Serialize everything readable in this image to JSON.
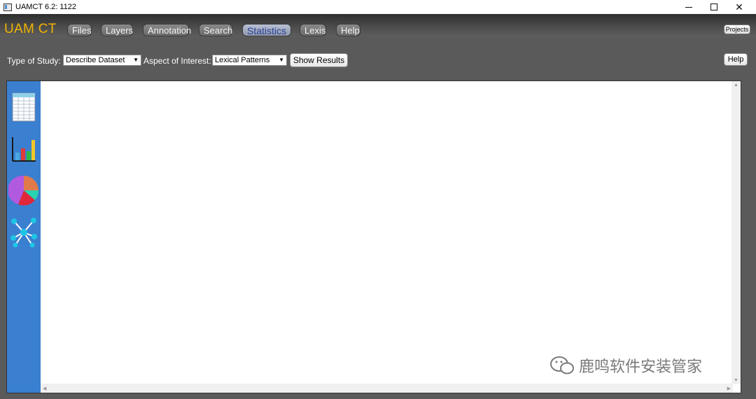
{
  "window": {
    "title": "UAMCT 6.2: 1122",
    "close_glyph": "✕"
  },
  "menubar": {
    "brand": "UAM CT",
    "tabs": [
      {
        "label": "Files"
      },
      {
        "label": "Layers"
      },
      {
        "label": "Annotation"
      },
      {
        "label": "Search"
      },
      {
        "label": "Statistics",
        "active": true
      },
      {
        "label": "Lexis"
      },
      {
        "label": "Help"
      }
    ],
    "projects_label": "Projects"
  },
  "toolbar": {
    "study_label": "Type of Study:",
    "study_value": "Describe Dataset",
    "aspect_label": "Aspect of Interest:",
    "aspect_value": "Lexical Patterns",
    "show_results_label": "Show Results",
    "help_label": "Help",
    "dropdown_glyph": "▼"
  },
  "sidebar": {
    "icons": [
      "spreadsheet-icon",
      "bar-chart-icon",
      "pie-chart-icon",
      "network-icon"
    ]
  },
  "watermark": {
    "text": "鹿鸣软件安装管家"
  },
  "colors": {
    "brand": "#f0b400",
    "sidebar": "#3b7fd0",
    "active_tab_text": "#2b3f9a"
  }
}
